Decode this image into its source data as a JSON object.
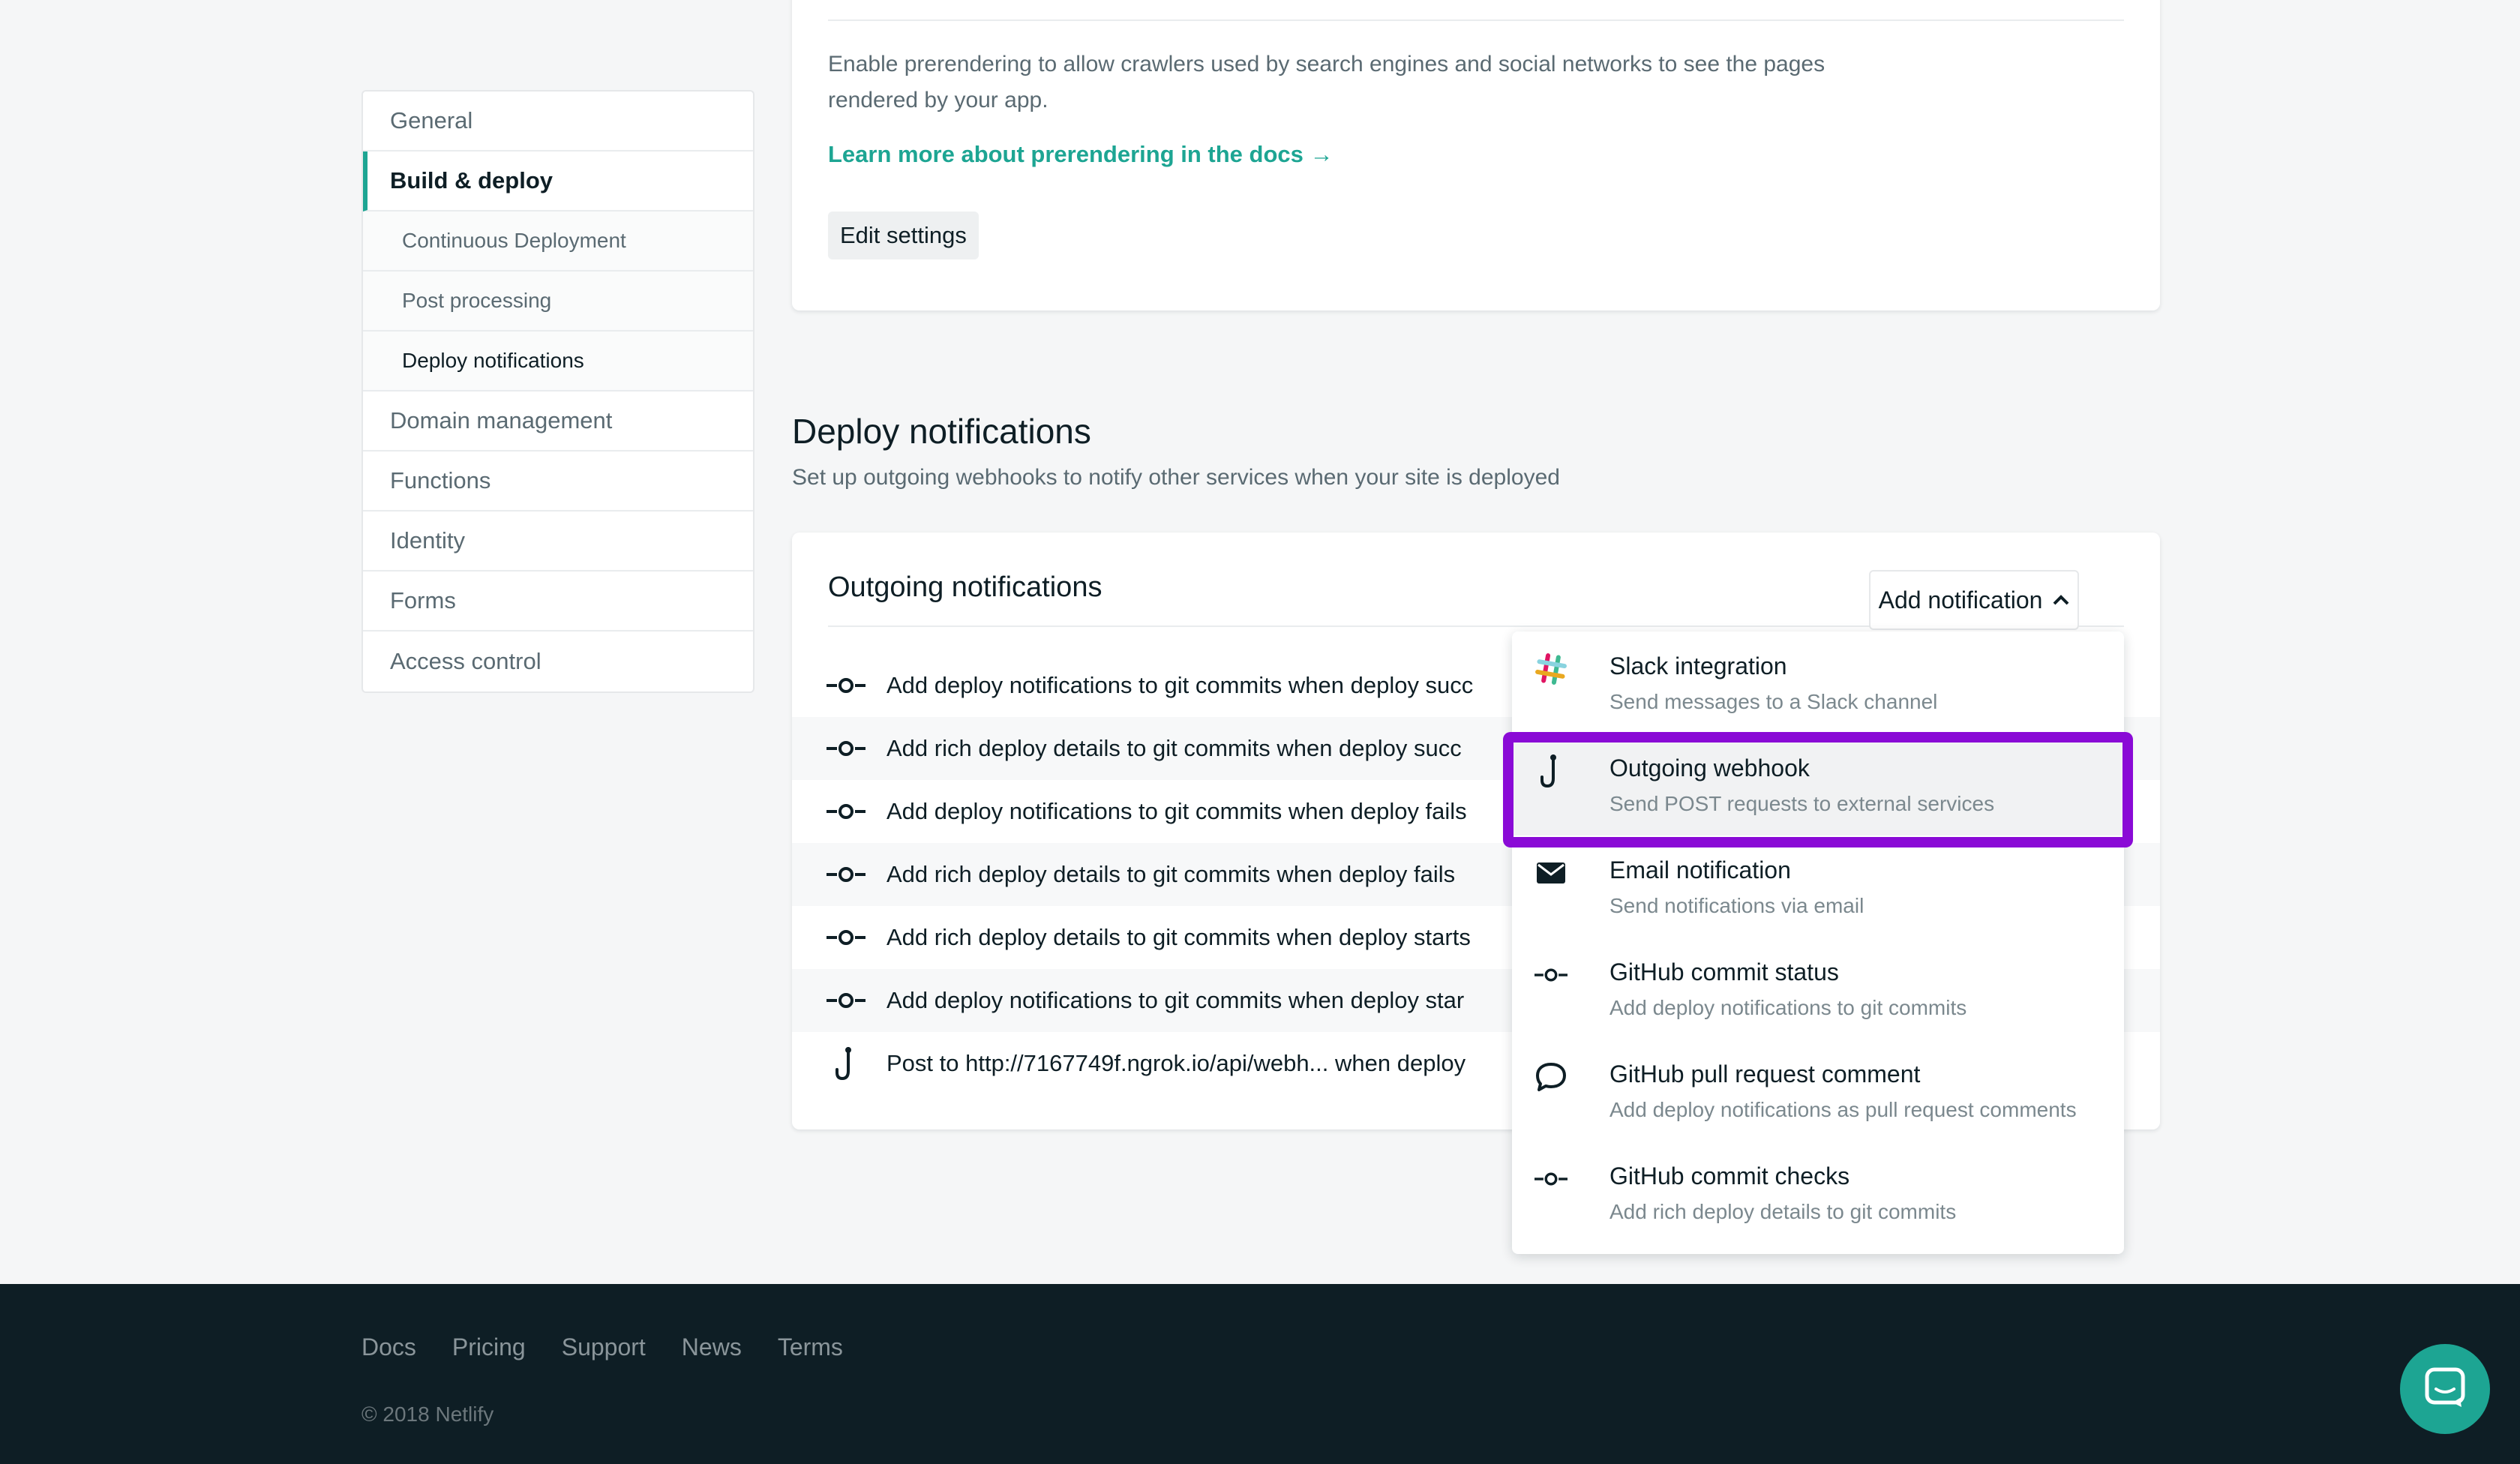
{
  "sidebar": {
    "items": [
      {
        "label": "General"
      },
      {
        "label": "Build & deploy"
      },
      {
        "label": "Continuous Deployment"
      },
      {
        "label": "Post processing"
      },
      {
        "label": "Deploy notifications"
      },
      {
        "label": "Domain management"
      },
      {
        "label": "Functions"
      },
      {
        "label": "Identity"
      },
      {
        "label": "Forms"
      },
      {
        "label": "Access control"
      }
    ]
  },
  "prerender": {
    "description": "Enable prerendering to allow crawlers used by search engines and social networks to see the pages rendered by your app.",
    "learn_more": "Learn more about prerendering in the docs →",
    "edit_label": "Edit settings"
  },
  "deploy_notifications": {
    "title": "Deploy notifications",
    "subtitle": "Set up outgoing webhooks to notify other services when your site is deployed",
    "card_title": "Outgoing notifications",
    "add_button": "Add notification",
    "rows": [
      {
        "icon": "git-commit-icon",
        "text": "Add deploy notifications to git commits when deploy succ"
      },
      {
        "icon": "git-commit-icon",
        "text": "Add rich deploy details to git commits when deploy succ"
      },
      {
        "icon": "git-commit-icon",
        "text": "Add deploy notifications to git commits when deploy fails"
      },
      {
        "icon": "git-commit-icon",
        "text": "Add rich deploy details to git commits when deploy fails"
      },
      {
        "icon": "git-commit-icon",
        "text": "Add rich deploy details to git commits when deploy starts"
      },
      {
        "icon": "git-commit-icon",
        "text": "Add deploy notifications to git commits when deploy star"
      },
      {
        "icon": "webhook-icon",
        "text": "Post to http://7167749f.ngrok.io/api/webh...  when deploy"
      }
    ]
  },
  "dropdown": {
    "items": [
      {
        "icon": "slack-icon",
        "title": "Slack integration",
        "desc": "Send messages to a Slack channel"
      },
      {
        "icon": "webhook-icon",
        "title": "Outgoing webhook",
        "desc": "Send POST requests to external services"
      },
      {
        "icon": "envelope-icon",
        "title": "Email notification",
        "desc": "Send notifications via email"
      },
      {
        "icon": "git-commit-icon",
        "title": "GitHub commit status",
        "desc": "Add deploy notifications to git commits"
      },
      {
        "icon": "comment-icon",
        "title": "GitHub pull request comment",
        "desc": "Add deploy notifications as pull request comments"
      },
      {
        "icon": "git-commit-icon",
        "title": "GitHub commit checks",
        "desc": "Add rich deploy details to git commits"
      }
    ]
  },
  "footer": {
    "links": [
      "Docs",
      "Pricing",
      "Support",
      "News",
      "Terms"
    ],
    "copyright": "© 2018 Netlify"
  },
  "colors": {
    "accent": "#1da593",
    "highlight": "#8a0ad6",
    "footer_bg": "#0e1e25"
  }
}
